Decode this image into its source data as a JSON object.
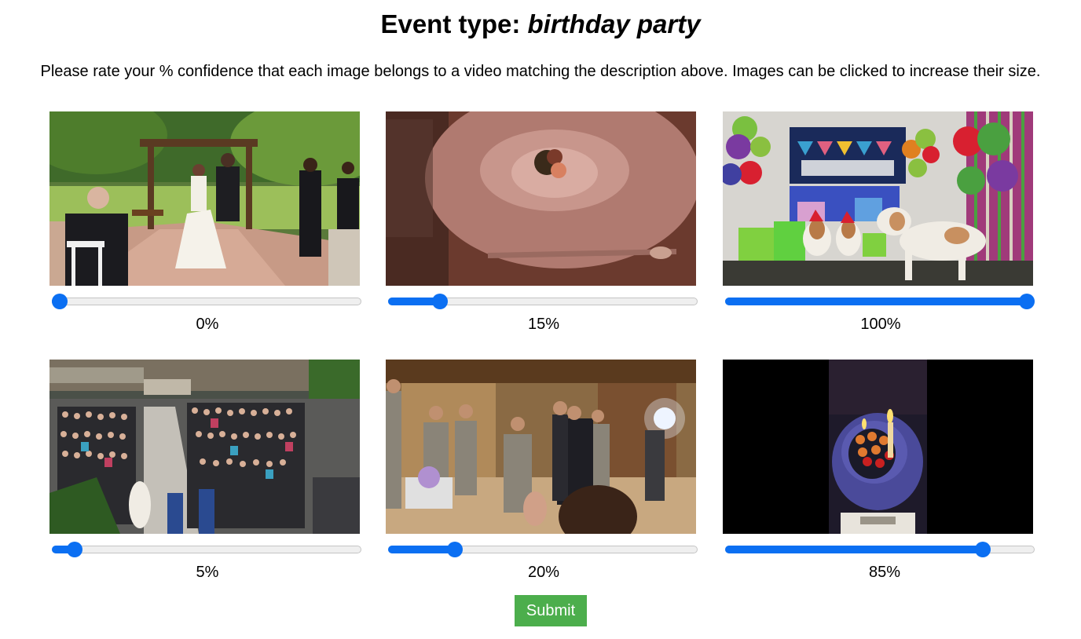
{
  "header": {
    "title_prefix": "Event type: ",
    "title_event": "birthday party",
    "instructions": "Please rate your % confidence that each image belongs to a video matching the description above. Images can be clicked to increase their size."
  },
  "items": [
    {
      "scene": "outdoor wedding ceremony",
      "confidence": 0,
      "label": "0%"
    },
    {
      "scene": "plated dessert on white dish",
      "confidence": 15,
      "label": "15%"
    },
    {
      "scene": "dogs at birthday party with balloons",
      "confidence": 100,
      "label": "100%"
    },
    {
      "scene": "crowded atrium wedding audience",
      "confidence": 5,
      "label": "5%"
    },
    {
      "scene": "groomsmen dancing in wood hall",
      "confidence": 20,
      "label": "20%"
    },
    {
      "scene": "birthday cake with candles",
      "confidence": 85,
      "label": "85%"
    }
  ],
  "submit_label": "Submit",
  "colors": {
    "accent": "#0b6ff2",
    "submit": "#4cae4c"
  }
}
